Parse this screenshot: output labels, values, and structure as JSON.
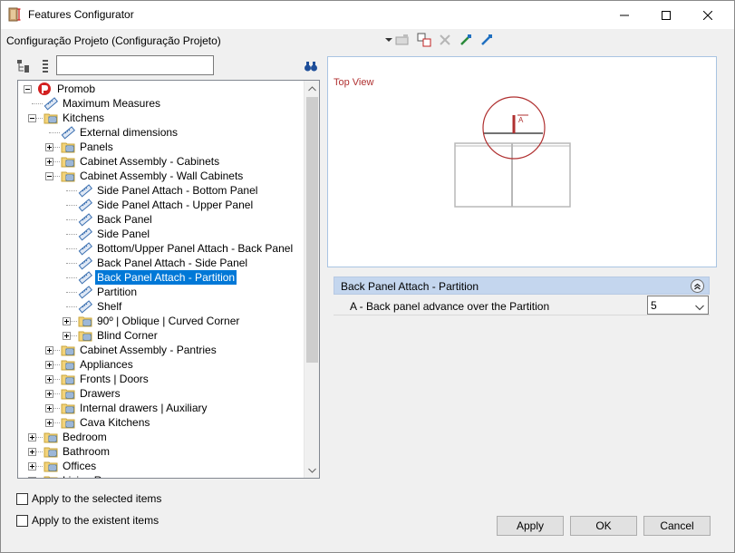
{
  "window": {
    "title": "Features Configurator",
    "app_icon": "configurator-app-icon"
  },
  "config": {
    "label": "Configuração Projeto (Configuração Projeto)"
  },
  "toolbar": {
    "icons": [
      "dropdown-arrow-icon",
      "apply-config-icon",
      "copy-config-icon",
      "delete-icon",
      "import-icon",
      "export-icon"
    ]
  },
  "tree_tools": {
    "search_value": "",
    "icons": [
      "tree-view-icon",
      "list-view-icon",
      "find-binoculars-icon"
    ]
  },
  "tree": {
    "root": "Promob",
    "nodes": [
      {
        "label": "Maximum Measures"
      },
      {
        "label": "Kitchens"
      },
      {
        "label": "External dimensions"
      },
      {
        "label": "Panels"
      },
      {
        "label": "Cabinet Assembly - Cabinets"
      },
      {
        "label": "Cabinet Assembly - Wall Cabinets"
      },
      {
        "label": "Side Panel Attach - Bottom Panel"
      },
      {
        "label": " Side Panel Attach - Upper Panel"
      },
      {
        "label": "Back Panel"
      },
      {
        "label": "Side Panel"
      },
      {
        "label": " Bottom/Upper Panel Attach - Back Panel"
      },
      {
        "label": "Back Panel Attach - Side Panel"
      },
      {
        "label": "Back Panel Attach - Partition"
      },
      {
        "label": "Partition"
      },
      {
        "label": "Shelf"
      },
      {
        "label": "90º | Oblique | Curved Corner"
      },
      {
        "label": "Blind Corner"
      },
      {
        "label": "Cabinet Assembly - Pantries"
      },
      {
        "label": "Appliances"
      },
      {
        "label": "Fronts | Doors"
      },
      {
        "label": "Drawers"
      },
      {
        "label": "Internal drawers | Auxiliary"
      },
      {
        "label": "Cava Kitchens"
      },
      {
        "label": "Bedroom"
      },
      {
        "label": "Bathroom"
      },
      {
        "label": "Offices"
      },
      {
        "label": "Living Rooms"
      }
    ]
  },
  "preview": {
    "title": "Top View",
    "marker_label": "A",
    "accent_color": "#b03030"
  },
  "properties": {
    "header": "Back Panel Attach - Partition",
    "rows": [
      {
        "label": "A - Back panel advance over the Partition",
        "value": "5"
      }
    ]
  },
  "options": {
    "apply_selected": "Apply to the selected items",
    "apply_existent": "Apply to the existent items"
  },
  "buttons": {
    "apply": "Apply",
    "ok": "OK",
    "cancel": "Cancel"
  },
  "colors": {
    "selection": "#0078d7",
    "header_bg": "#c4d6ee"
  }
}
